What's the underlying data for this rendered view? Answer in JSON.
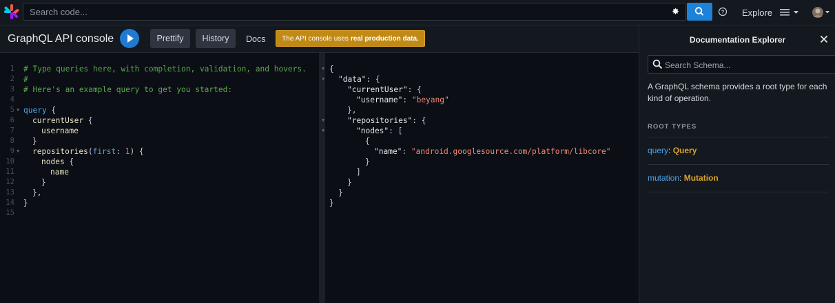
{
  "header": {
    "search_placeholder": "Search code...",
    "explore_label": "Explore",
    "search_button_icon": "search-icon",
    "help_icon": "help-circle-icon",
    "menu_icon": "hamburger-menu-icon"
  },
  "toolbar": {
    "title": "GraphQL API console",
    "run_icon": "play-icon",
    "prettify_label": "Prettify",
    "history_label": "History",
    "docs_label": "Docs",
    "warning_prefix": "The API console uses",
    "warning_bold": "real production data."
  },
  "editor": {
    "line_numbers": [
      "1",
      "2",
      "3",
      "4",
      "5",
      "6",
      "7",
      "8",
      "9",
      "10",
      "11",
      "12",
      "13",
      "14",
      "15"
    ],
    "lines": {
      "l1": "# Type queries here, with completion, validation, and hovers.",
      "l2": "#",
      "l3": "# Here's an example query to get you started:",
      "l5_kw": "query",
      "l5_p": " {",
      "l6_f": "currentUser",
      "l6_p": " {",
      "l7_f": "username",
      "l8_p": "}",
      "l9_f": "repositories",
      "l9_p1": "(",
      "l9_arg": "first",
      "l9_p2": ": ",
      "l9_num": "1",
      "l9_p3": ") {",
      "l10_f": "nodes",
      "l10_p": " {",
      "l11_f": "name",
      "l12_p": "}",
      "l13_p": "},",
      "l14_p": "}"
    }
  },
  "result": {
    "r1": "{",
    "r2_k": "\"data\"",
    "r2_p": ": {",
    "r3_k": "\"currentUser\"",
    "r3_p": ": {",
    "r4_k": "\"username\"",
    "r4_p": ": ",
    "r4_v": "\"beyang\"",
    "r5": "},",
    "r6_k": "\"repositories\"",
    "r6_p": ": {",
    "r7_k": "\"nodes\"",
    "r7_p": ": [",
    "r8": "{",
    "r9_k": "\"name\"",
    "r9_p": ": ",
    "r9_v": "\"android.googlesource.com/platform/libcore\"",
    "r10": "}",
    "r11": "]",
    "r12": "}",
    "r13": "}",
    "r14": "}"
  },
  "docs_panel": {
    "title": "Documentation Explorer",
    "search_placeholder": "Search Schema...",
    "description": "A GraphQL schema provides a root type for each kind of operation.",
    "root_types_heading": "ROOT TYPES",
    "root_types": [
      {
        "name": "query",
        "type": "Query"
      },
      {
        "name": "mutation",
        "type": "Mutation"
      }
    ]
  },
  "colors": {
    "accent_blue": "#1d82d8",
    "warning_bg": "#c18a16",
    "type_gold": "#d9a22c"
  }
}
